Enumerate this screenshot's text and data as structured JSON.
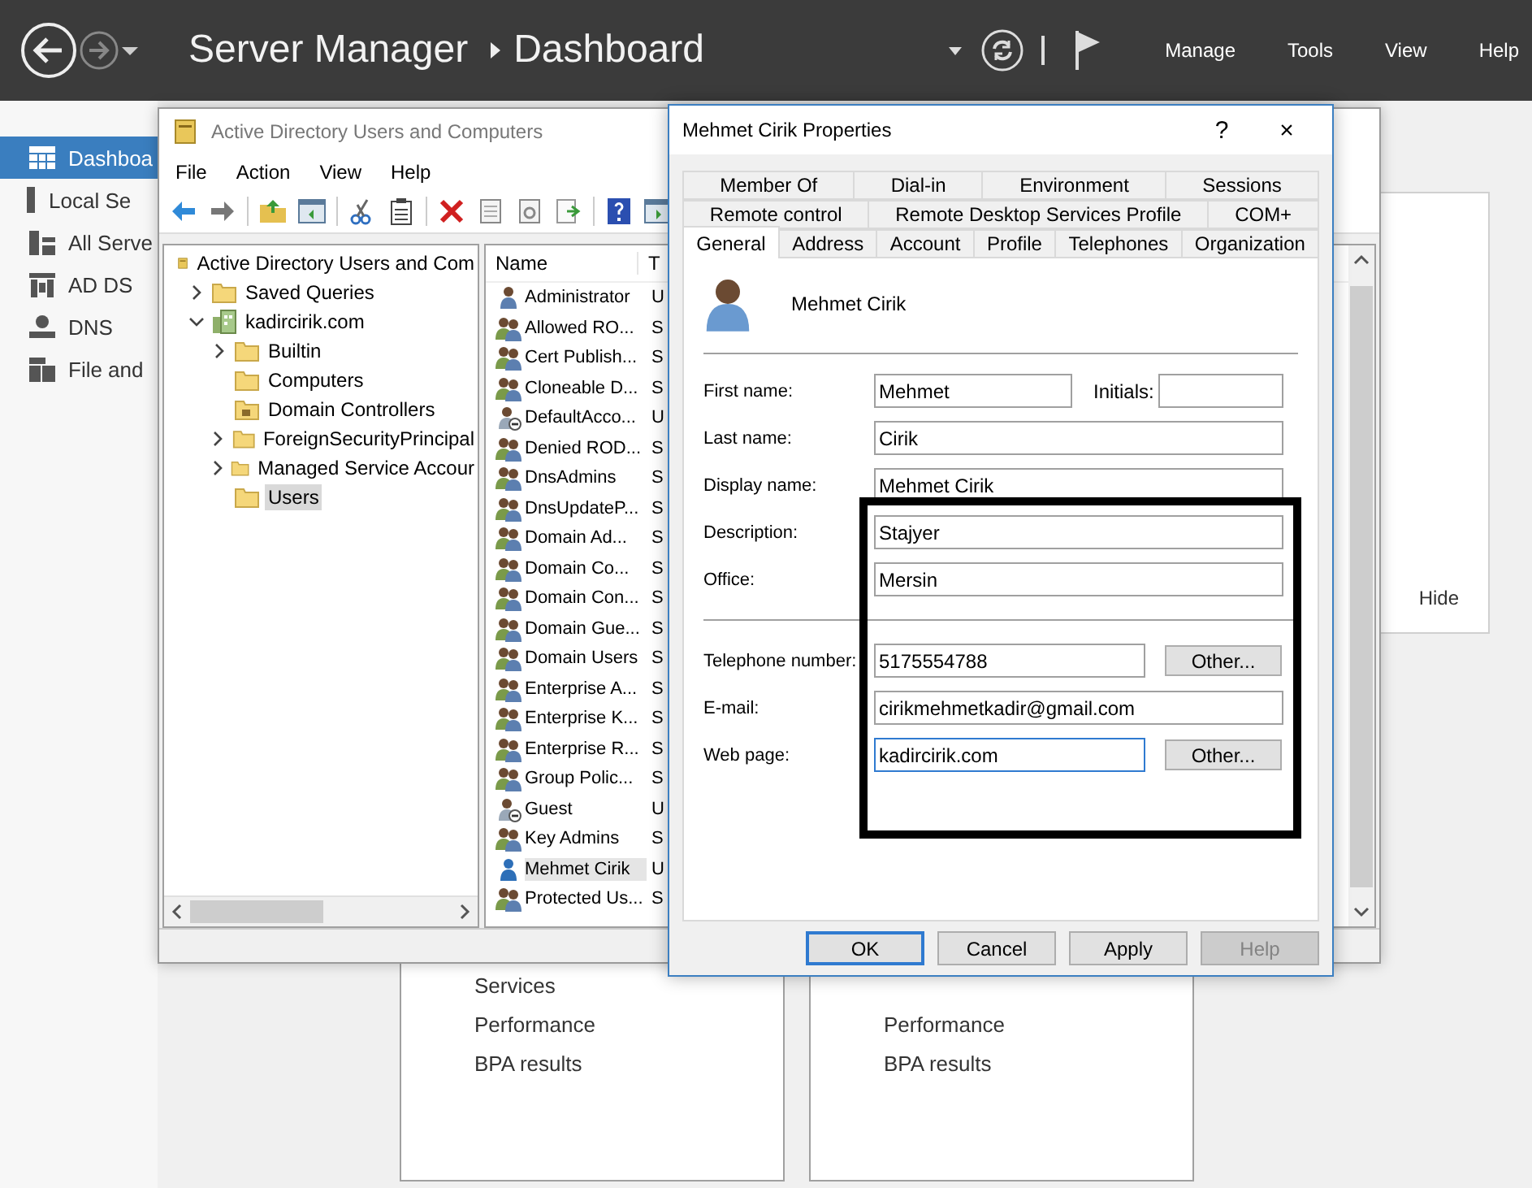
{
  "header": {
    "breadcrumb": [
      "Server Manager",
      "Dashboard"
    ],
    "menu": [
      "Manage",
      "Tools",
      "View",
      "Help"
    ]
  },
  "sidebar": {
    "items": [
      {
        "label": "Dashboa",
        "kind": "dashboard",
        "selected": true
      },
      {
        "label": "Local Se",
        "kind": "server",
        "selected": false
      },
      {
        "label": "All Serve",
        "kind": "servers",
        "selected": false
      },
      {
        "label": "AD DS",
        "kind": "adds",
        "selected": false
      },
      {
        "label": "DNS",
        "kind": "dns",
        "selected": false
      },
      {
        "label": "File and",
        "kind": "file",
        "selected": false
      }
    ]
  },
  "dashboard": {
    "hide_label": "Hide",
    "tiles": [
      {
        "links": [
          "Services",
          "Performance",
          "BPA results"
        ]
      },
      {
        "links": [
          "Performance",
          "BPA results"
        ]
      }
    ]
  },
  "aduc": {
    "title": "Active Directory Users and Computers",
    "menu": [
      "File",
      "Action",
      "View",
      "Help"
    ],
    "tree": [
      {
        "label": "Active Directory Users and Com",
        "kind": "snapin",
        "selected": false,
        "children": [
          {
            "label": "Saved Queries",
            "kind": "folder",
            "selected": false,
            "expanded": false
          },
          {
            "label": "kadircirik.com",
            "kind": "domain",
            "selected": false,
            "expanded": true,
            "children": [
              {
                "label": "Builtin",
                "kind": "folder",
                "selected": false,
                "expanded": false
              },
              {
                "label": "Computers",
                "kind": "folder",
                "selected": false
              },
              {
                "label": "Domain Controllers",
                "kind": "ou",
                "selected": false
              },
              {
                "label": "ForeignSecurityPrincipal",
                "kind": "folder",
                "selected": false,
                "expanded": false
              },
              {
                "label": "Managed Service Accour",
                "kind": "folder",
                "selected": false,
                "expanded": false
              },
              {
                "label": "Users",
                "kind": "folder",
                "selected": true
              }
            ]
          }
        ]
      }
    ],
    "columns": [
      "Name",
      "T"
    ],
    "rows": [
      {
        "name": "Administrator",
        "type": "U",
        "kind": "user",
        "selected": false
      },
      {
        "name": "Allowed RO...",
        "type": "S",
        "kind": "group",
        "selected": false
      },
      {
        "name": "Cert Publish...",
        "type": "S",
        "kind": "group",
        "selected": false
      },
      {
        "name": "Cloneable D...",
        "type": "S",
        "kind": "group",
        "selected": false
      },
      {
        "name": "DefaultAcco...",
        "type": "U",
        "kind": "disabled-user",
        "selected": false
      },
      {
        "name": "Denied ROD...",
        "type": "S",
        "kind": "group",
        "selected": false
      },
      {
        "name": "DnsAdmins",
        "type": "S",
        "kind": "group",
        "selected": false
      },
      {
        "name": "DnsUpdateP...",
        "type": "S",
        "kind": "group",
        "selected": false
      },
      {
        "name": "Domain Ad...",
        "type": "S",
        "kind": "group",
        "selected": false
      },
      {
        "name": "Domain Co...",
        "type": "S",
        "kind": "group",
        "selected": false
      },
      {
        "name": "Domain Con...",
        "type": "S",
        "kind": "group",
        "selected": false
      },
      {
        "name": "Domain Gue...",
        "type": "S",
        "kind": "group",
        "selected": false
      },
      {
        "name": "Domain Users",
        "type": "S",
        "kind": "group",
        "selected": false
      },
      {
        "name": "Enterprise A...",
        "type": "S",
        "kind": "group",
        "selected": false
      },
      {
        "name": "Enterprise K...",
        "type": "S",
        "kind": "group",
        "selected": false
      },
      {
        "name": "Enterprise R...",
        "type": "S",
        "kind": "group",
        "selected": false
      },
      {
        "name": "Group Polic...",
        "type": "S",
        "kind": "group",
        "selected": false
      },
      {
        "name": "Guest",
        "type": "U",
        "kind": "disabled-user",
        "selected": false
      },
      {
        "name": "Key Admins",
        "type": "S",
        "kind": "group",
        "selected": false
      },
      {
        "name": "Mehmet Cirik",
        "type": "U",
        "kind": "new-user",
        "selected": true
      },
      {
        "name": "Protected Us...",
        "type": "S",
        "kind": "group",
        "selected": false
      }
    ]
  },
  "dialog": {
    "title": "Mehmet Cirik Properties",
    "help": "?",
    "close": "×",
    "tab_rows": [
      [
        {
          "label": "Member Of",
          "selected": false
        },
        {
          "label": "Dial-in",
          "selected": false
        },
        {
          "label": "Environment",
          "selected": false
        },
        {
          "label": "Sessions",
          "selected": false
        }
      ],
      [
        {
          "label": "Remote control",
          "selected": false
        },
        {
          "label": "Remote Desktop Services Profile",
          "selected": false
        },
        {
          "label": "COM+",
          "selected": false
        }
      ],
      [
        {
          "label": "General",
          "selected": true
        },
        {
          "label": "Address",
          "selected": false
        },
        {
          "label": "Account",
          "selected": false
        },
        {
          "label": "Profile",
          "selected": false
        },
        {
          "label": "Telephones",
          "selected": false
        },
        {
          "label": "Organization",
          "selected": false
        }
      ]
    ],
    "user_name": "Mehmet Cirik",
    "groups": [
      [
        {
          "label": "First name:",
          "value": "Mehmet",
          "extra_label": "Initials:",
          "focused": false
        },
        {
          "label": "Last name:",
          "value": "Cirik",
          "focused": false
        },
        {
          "label": "Display name:",
          "value": "Mehmet Cirik",
          "focused": false
        },
        {
          "label": "Description:",
          "value": "Stajyer",
          "focused": false
        },
        {
          "label": "Office:",
          "value": "Mersin",
          "focused": false
        }
      ],
      [
        {
          "label": "Telephone number:",
          "value": "5175554788",
          "button": "Other...",
          "focused": false
        },
        {
          "label": "E-mail:",
          "value": "cirikmehmetkadir@gmail.com",
          "focused": false
        },
        {
          "label": "Web page:",
          "value": "kadircirik.com",
          "button": "Other...",
          "focused": true
        }
      ]
    ],
    "buttons": [
      {
        "label": "OK",
        "default": true,
        "disabled": false
      },
      {
        "label": "Cancel",
        "default": false,
        "disabled": false
      },
      {
        "label": "Apply",
        "default": false,
        "disabled": false
      },
      {
        "label": "Help",
        "default": false,
        "disabled": true
      }
    ]
  },
  "annotation_frame": true
}
